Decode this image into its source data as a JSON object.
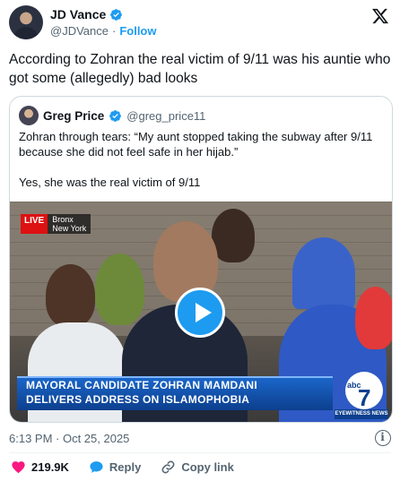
{
  "author": {
    "name": "JD Vance",
    "handle": "@JDVance",
    "separator": "·",
    "follow_label": "Follow"
  },
  "tweet": {
    "text": "According to Zohran the real victim of 9/11 was his auntie who got some (allegedly) bad looks",
    "timestamp": "6:13 PM · Oct 25, 2025"
  },
  "quote": {
    "name": "Greg Price",
    "handle": "@greg_price11",
    "text_1": "Zohran through tears: “My aunt stopped taking the subway after 9/11 because she did not feel safe in her hijab.”",
    "text_2": "Yes, she was the real victim of 9/11"
  },
  "video": {
    "live_label": "LIVE",
    "location_line1": "Bronx",
    "location_line2": "New York",
    "chyron_line1": "MAYORAL CANDIDATE ZOHRAN MAMDANI",
    "chyron_line2": "DELIVERS ADDRESS ON ISLAMOPHOBIA",
    "station_logo": "abc7",
    "station_tag": "EYEWITNESS NEWS"
  },
  "actions": {
    "like_count": "219.9K",
    "reply_label": "Reply",
    "copy_link_label": "Copy link"
  },
  "icons": {
    "verified": "verified-badge-icon",
    "x_logo": "x-logo-icon",
    "info": "info-icon",
    "like": "heart-icon",
    "reply": "reply-bubble-icon",
    "link": "link-icon",
    "play": "play-icon"
  },
  "colors": {
    "accent": "#1d9bf0",
    "like": "#f91880",
    "secondary_text": "#536471"
  }
}
